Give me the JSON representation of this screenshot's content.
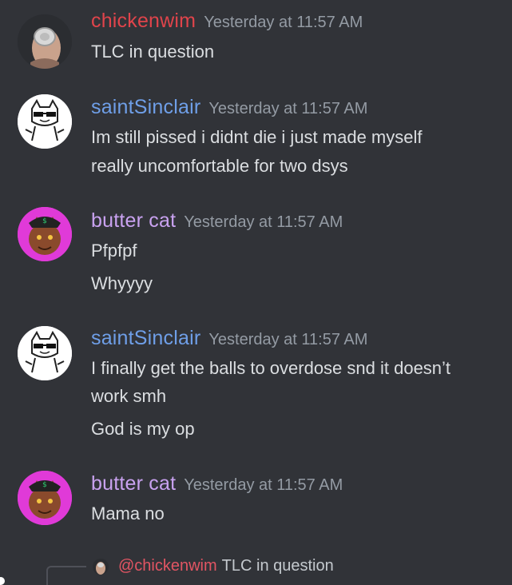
{
  "messages": [
    {
      "author": "chickenwim",
      "author_color": "#e0444b",
      "timestamp": "Yesterday at 11:57 AM",
      "avatar_icon": "chickenwim-avatar-icon",
      "lines": [
        "TLC in question"
      ]
    },
    {
      "author": "saintSinclair",
      "author_color": "#6f9fe8",
      "timestamp": "Yesterday at 11:57 AM",
      "avatar_icon": "cat-sunglasses-avatar-icon",
      "lines": [
        "Im still pissed i didnt die i just made myself",
        "really uncomfortable for two dsys"
      ]
    },
    {
      "author": "butter cat",
      "author_color": "#c9a2f0",
      "timestamp": "Yesterday at 11:57 AM",
      "avatar_icon": "butter-cat-avatar-icon",
      "lines": [
        "Pfpfpf",
        "Whyyyy"
      ]
    },
    {
      "author": "saintSinclair",
      "author_color": "#6f9fe8",
      "timestamp": "Yesterday at 11:57 AM",
      "avatar_icon": "cat-sunglasses-avatar-icon",
      "lines": [
        "I finally get the balls to overdose snd it doesn’t",
        "work smh",
        "God is my op"
      ]
    },
    {
      "author": "butter cat",
      "author_color": "#c9a2f0",
      "timestamp": "Yesterday at 11:57 AM",
      "avatar_icon": "butter-cat-avatar-icon",
      "lines": [
        "Mama no"
      ]
    }
  ],
  "reply": {
    "mention": "@chickenwim",
    "text": "TLC in question",
    "avatar_icon": "chickenwim-avatar-icon"
  }
}
